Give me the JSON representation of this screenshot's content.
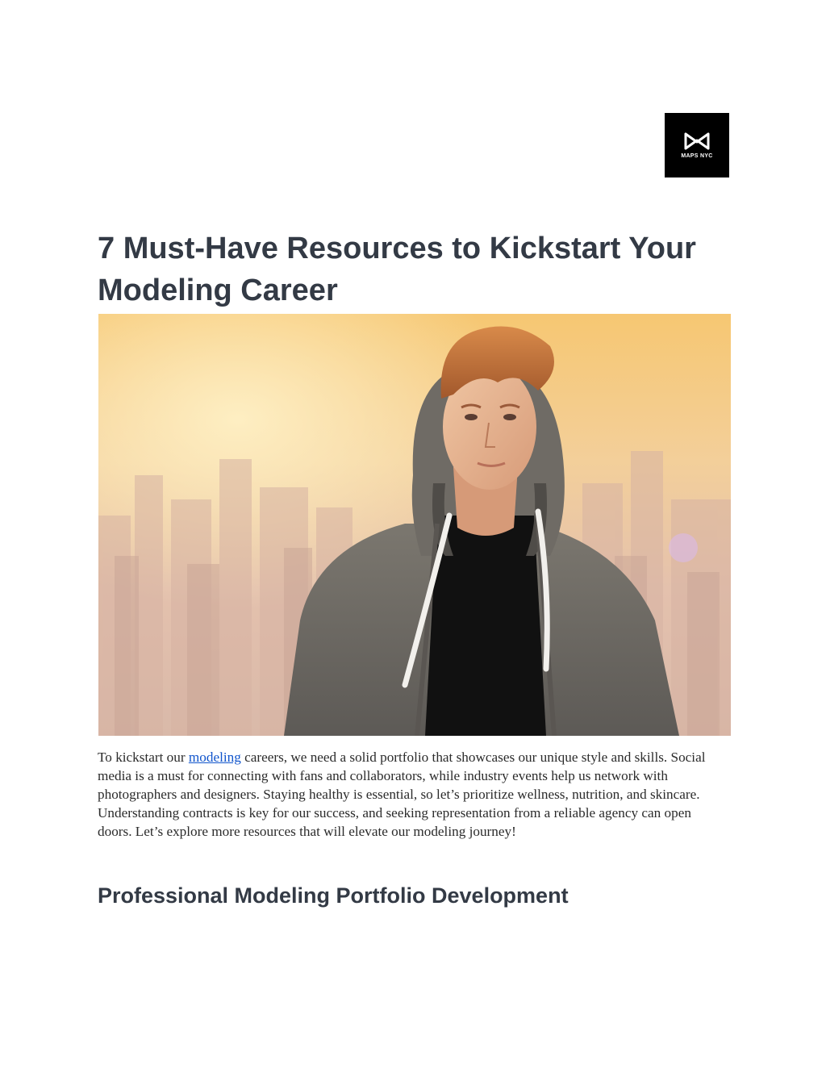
{
  "logo": {
    "text": "MAPS NYC",
    "icon": "mn-monogram-icon"
  },
  "article": {
    "title": "7 Must-Have Resources to Kickstart Your Modeling Career",
    "intro": {
      "before_link": "To kickstart our ",
      "link_text": "modeling",
      "after_link": " careers, we need a solid portfolio that showcases our unique style and skills. Social media is a must for connecting with fans and collaborators, while industry events help us network with photographers and designers. Staying healthy is essential, so let’s prioritize wellness, nutrition, and skincare. Understanding contracts is key for our success, and seeking representation from a reliable agency can open doors. Let’s explore more resources that will elevate our modeling journey!"
    },
    "section_heading": "Professional Modeling Portfolio Development"
  },
  "colors": {
    "heading": "#333a45",
    "link": "#1155cc",
    "body_text": "#2b2b2b",
    "logo_bg": "#000000"
  }
}
